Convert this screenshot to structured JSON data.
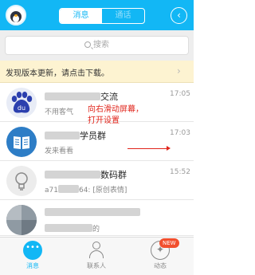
{
  "header": {
    "tabs": [
      {
        "label": "消息",
        "active": true
      },
      {
        "label": "通话",
        "active": false
      }
    ],
    "back_icon": "back-circle-icon"
  },
  "search": {
    "placeholder": "搜索"
  },
  "update_notice": {
    "text": "发现版本更新，请点击下载。"
  },
  "conversations": [
    {
      "title_visible": "交流",
      "preview": "不用客气",
      "time": "17:05",
      "icon": "baidu-logo-icon"
    },
    {
      "title_visible": "学员群",
      "preview": "发来看看",
      "time": "17:03",
      "icon": "book-icon"
    },
    {
      "title_visible": "数码群",
      "preview_prefix": "a71",
      "preview_suffix": "64: [原创表情]",
      "time": "15:52",
      "icon": "lightbulb-icon"
    },
    {
      "title_visible": "",
      "preview": "的",
      "time": "",
      "icon": "photo-avatar"
    }
  ],
  "annotation": {
    "line1": "向右滑动屏幕，",
    "line2": "打开设置",
    "color": "#e0251b"
  },
  "bottom_nav": [
    {
      "label": "消息",
      "active": true
    },
    {
      "label": "联系人",
      "active": false
    },
    {
      "label": "动态",
      "active": false
    }
  ],
  "badge": {
    "text": "NEW"
  },
  "colors": {
    "accent": "#12b7f5",
    "notice_bg": "#fdf3d1",
    "badge": "#f24f2e"
  }
}
